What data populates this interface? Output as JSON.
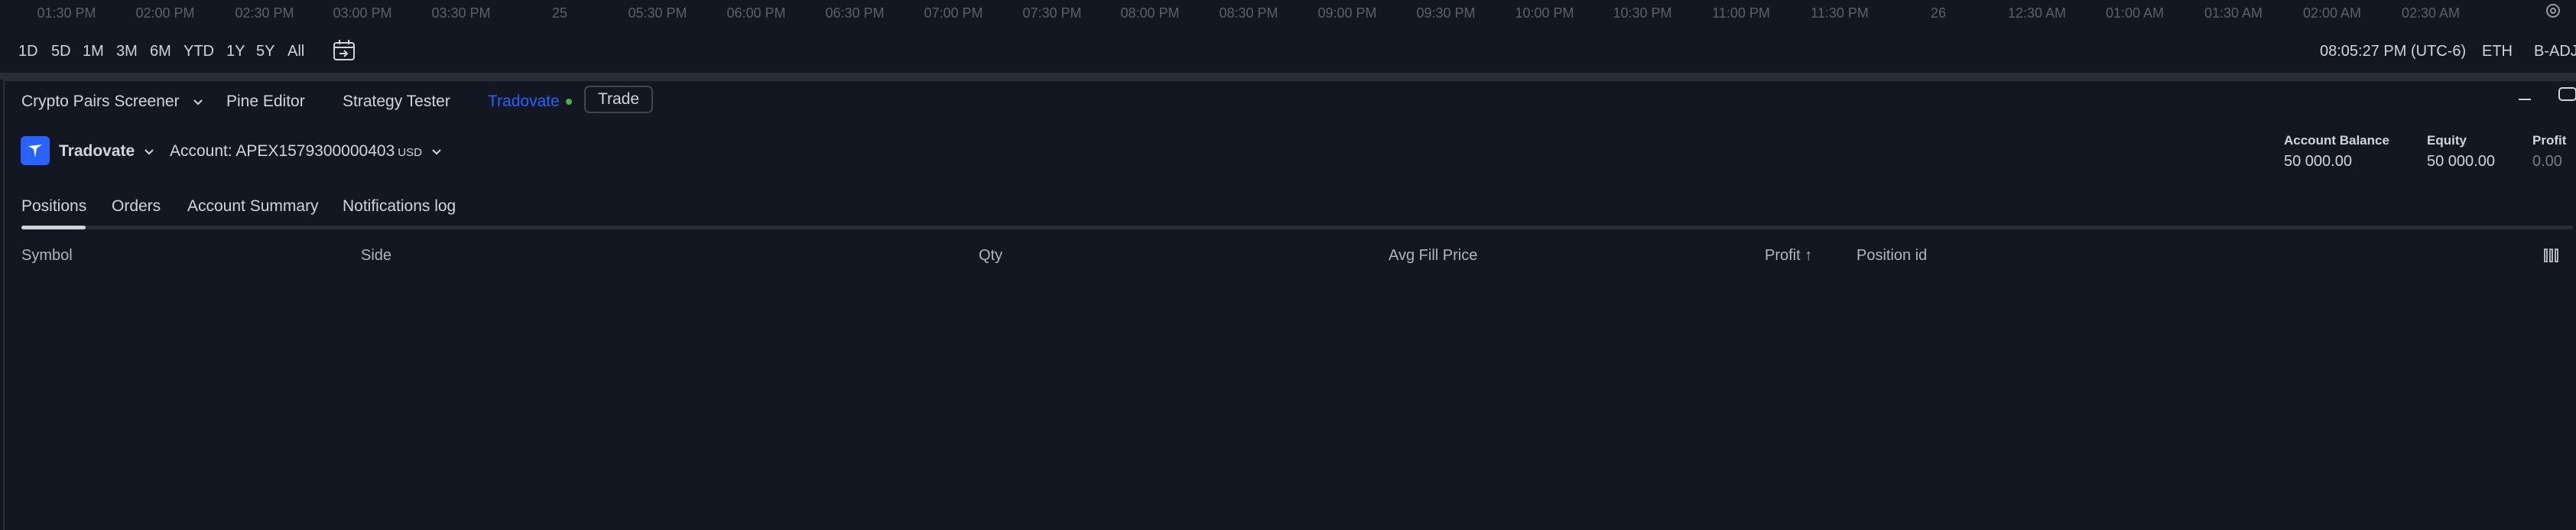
{
  "time_axis": {
    "labels": [
      "01:30 PM",
      "02:00 PM",
      "02:30 PM",
      "03:00 PM",
      "03:30 PM",
      "25",
      "05:30 PM",
      "06:00 PM",
      "06:30 PM",
      "07:00 PM",
      "07:30 PM",
      "08:00 PM",
      "08:30 PM",
      "09:00 PM",
      "09:30 PM",
      "10:00 PM",
      "10:30 PM",
      "11:00 PM",
      "11:30 PM",
      "26",
      "12:30 AM",
      "01:00 AM",
      "01:30 AM",
      "02:00 AM",
      "02:30 AM"
    ]
  },
  "range_bar": {
    "ranges": [
      "1D",
      "5D",
      "1M",
      "3M",
      "6M",
      "YTD",
      "1Y",
      "5Y",
      "All"
    ],
    "clock": "08:05:27 PM (UTC-6)",
    "session": "ETH",
    "adj": "B-ADJ"
  },
  "panel_tabs": {
    "screener": "Crypto Pairs Screener",
    "pine": "Pine Editor",
    "strategy": "Strategy Tester",
    "broker": "Tradovate",
    "trade": "Trade"
  },
  "broker": {
    "name": "Tradovate",
    "account_label": "Account: APEX1579300000403",
    "currency": "USD"
  },
  "metrics": {
    "balance_label": "Account Balance",
    "balance_value": "50 000.00",
    "equity_label": "Equity",
    "equity_value": "50 000.00",
    "profit_label": "Profit",
    "profit_value": "0.00"
  },
  "sub_tabs": [
    "Positions",
    "Orders",
    "Account Summary",
    "Notifications log"
  ],
  "table": {
    "columns": [
      "Symbol",
      "Side",
      "Qty",
      "Avg Fill Price",
      "Profit ↑",
      "Position id"
    ]
  },
  "colors": {
    "accent": "#2962ff",
    "background": "#131722",
    "online": "#4caf50"
  }
}
